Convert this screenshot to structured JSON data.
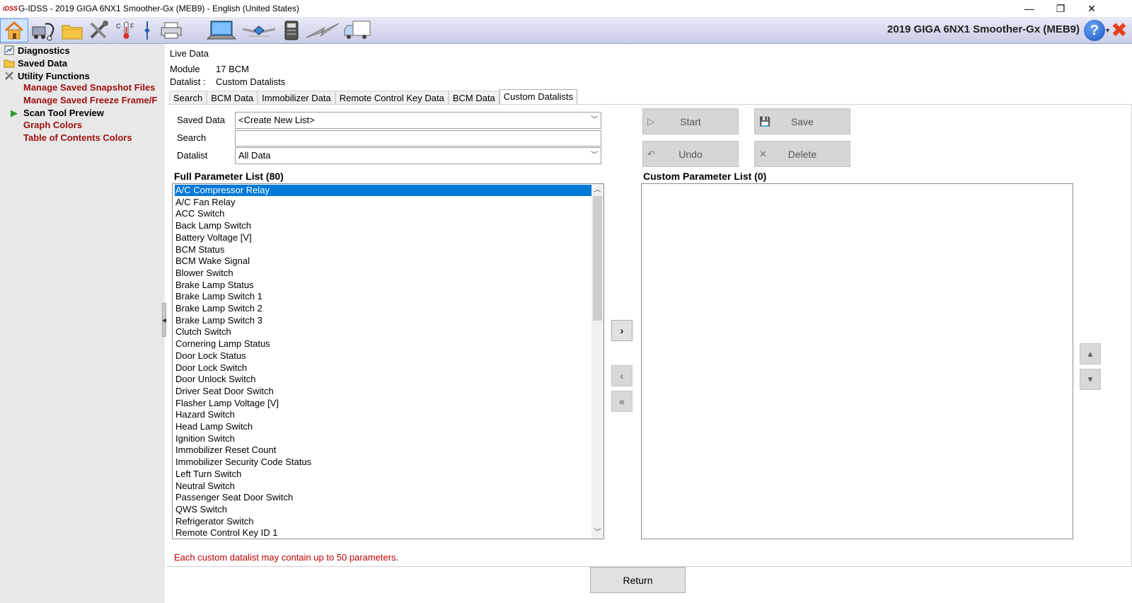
{
  "window": {
    "app_logo": "iDSS",
    "title": "G-IDSS - 2019 GIGA 6NX1 Smoother-Gx (MEB9) - English (United States)",
    "controls": {
      "minimize": "—",
      "restore": "❐",
      "close": "✕"
    }
  },
  "toolbar": {
    "vehicle_title": "2019 GIGA 6NX1 Smoother-Gx (MEB9)",
    "help_label": "?",
    "exit_label": "✖",
    "icons": [
      "home-icon",
      "vehicle-diagnose-icon",
      "folder-icon",
      "tools-icon",
      "temperature-convert-icon",
      "divider-icon",
      "printer-icon",
      "laptop-icon",
      "satellite-icon",
      "device-icon",
      "lightning-icon",
      "truck-icon"
    ],
    "temp_label": "C|F"
  },
  "sidebar": {
    "items": [
      {
        "label": "Diagnostics",
        "icon": "diagnostics-icon"
      },
      {
        "label": "Saved Data",
        "icon": "folder-icon"
      },
      {
        "label": "Utility Functions",
        "icon": "tools-icon"
      }
    ],
    "subitems": [
      {
        "label": "Manage Saved Snapshot Files"
      },
      {
        "label": "Manage Saved Freeze Frame/F"
      },
      {
        "label": "Scan Tool Preview",
        "active": true
      },
      {
        "label": "Graph Colors"
      },
      {
        "label": "Table of Contents Colors"
      }
    ]
  },
  "header": {
    "title": "Live Data",
    "module_label": "Module",
    "module_value": "17 BCM",
    "datalist_label": "Datalist :",
    "datalist_value": "Custom Datalists"
  },
  "tabs": [
    {
      "label": "Search"
    },
    {
      "label": "BCM Data"
    },
    {
      "label": "Immobilizer Data"
    },
    {
      "label": "Remote Control Key Data"
    },
    {
      "label": "BCM Data"
    },
    {
      "label": "Custom Datalists",
      "active": true
    }
  ],
  "form": {
    "saved_data_label": "Saved Data",
    "saved_data_value": "<Create New List>",
    "search_label": "Search",
    "search_value": "",
    "datalist_label": "Datalist",
    "datalist_value": "All Data"
  },
  "actions": {
    "start": "Start",
    "save": "Save",
    "undo": "Undo",
    "delete": "Delete"
  },
  "full_list": {
    "title": "Full Parameter List (80)",
    "items": [
      "A/C Compressor Relay",
      "A/C Fan Relay",
      "ACC Switch",
      "Back Lamp Switch",
      "Battery Voltage [V]",
      "BCM Status",
      "BCM Wake Signal",
      "Blower Switch",
      "Brake Lamp Status",
      "Brake Lamp Switch 1",
      "Brake Lamp Switch 2",
      "Brake Lamp Switch 3",
      "Clutch Switch",
      "Cornering Lamp Status",
      "Door Lock Status",
      "Door Lock Switch",
      "Door Unlock Switch",
      "Driver Seat Door Switch",
      "Flasher Lamp Voltage [V]",
      "Hazard Switch",
      "Head Lamp Switch",
      "Ignition Switch",
      "Immobilizer Reset Count",
      "Immobilizer Security Code Status",
      "Left Turn Switch",
      "Neutral Switch",
      "Passenger Seat Door Switch",
      "QWS Switch",
      "Refrigerator Switch",
      "Remote Control Key ID 1"
    ],
    "selected_index": 0
  },
  "custom_list": {
    "title": "Custom Parameter List (0)",
    "items": []
  },
  "transfer": {
    "add": "›",
    "remove": "‹",
    "remove_all": "«"
  },
  "order": {
    "up": "▲",
    "down": "▼"
  },
  "footnote": "Each custom datalist may contain up to 50 parameters.",
  "return_label": "Return"
}
